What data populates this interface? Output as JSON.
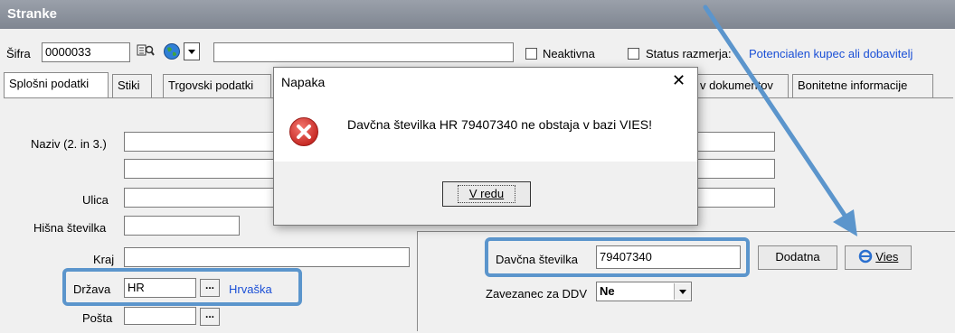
{
  "window": {
    "title": "Stranke"
  },
  "top": {
    "sifra_label": "Šifra",
    "sifra_value": "0000033",
    "neaktivna_label": "Neaktivna",
    "status_label": "Status razmerja:",
    "status_value": "Potencialen kupec ali dobavitelj"
  },
  "tabs": [
    {
      "label": "Splošni podatki"
    },
    {
      "label": "Stiki"
    },
    {
      "label": "Trgovski podatki"
    },
    {
      "label": "v dokumentov"
    },
    {
      "label": "Bonitetne informacije"
    }
  ],
  "form": {
    "naziv_label": "Naziv (2. in 3.)",
    "ulica_label": "Ulica",
    "hisna_label": "Hišna številka",
    "kraj_label": "Kraj",
    "drzava_label": "Država",
    "drzava_value": "HR",
    "drzava_name": "Hrvaška",
    "posta_label": "Pošta",
    "davcna_label": "Davčna številka",
    "davcna_value": "79407340",
    "dodatna_label": "Dodatna",
    "vies_label": "Vies",
    "zavezanec_label": "Zavezanec za DDV",
    "zavezanec_value": "Ne",
    "dots": "..."
  },
  "dialog": {
    "title": "Napaka",
    "close": "✕",
    "message": "Davčna številka HR 79407340 ne obstaja v bazi VIES!",
    "ok_label": "V redu"
  },
  "colors": {
    "highlight": "#5b95cc",
    "link": "#1a4fd6",
    "error": "#d9302b"
  }
}
